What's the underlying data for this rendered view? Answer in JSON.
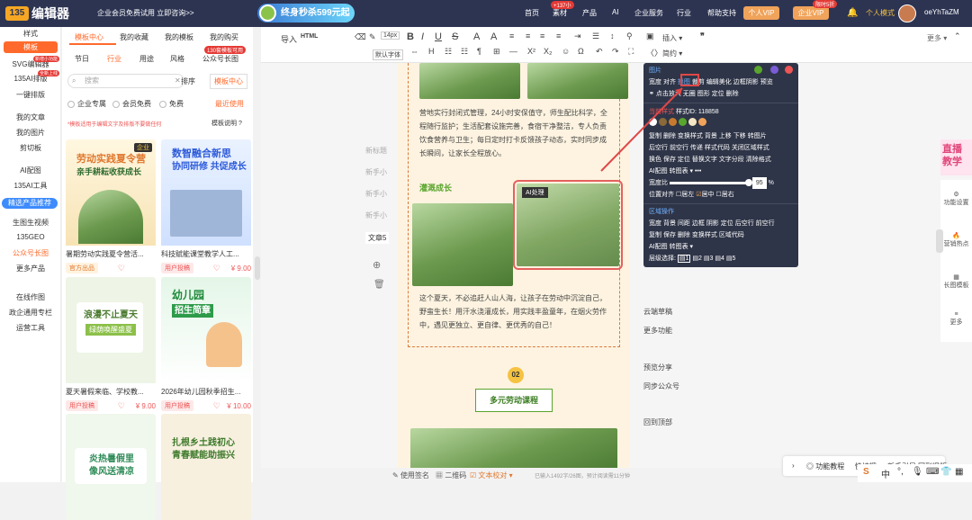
{
  "topbar": {
    "logo_text": "编辑器",
    "promo": "企业会员免费试用 立即咨询>>",
    "flash_sale": "终身秒杀599元起",
    "nav": [
      "首页",
      "素材",
      "产品",
      "AI",
      "企业服务",
      "行业",
      "帮助支持"
    ],
    "material_badge": "+137小",
    "vip": "个人VIP",
    "enterprise_vip": "企业VIP",
    "enterprise_badge": "限时5折",
    "mode": "个人模式",
    "username": "oeYhTaZM"
  },
  "leftnav": {
    "items": [
      "样式",
      "模板",
      "SVG编辑器",
      "135AI排版",
      "一键排版",
      "我的文章",
      "我的图片",
      "剪切板",
      "AI配图",
      "135AI工具",
      "精选产品推荐",
      "生图生视频",
      "135GEO",
      "公众号长图",
      "更多产品",
      "在线作图",
      "政企通用专栏",
      "运营工具"
    ],
    "badges": {
      "svg": "新增小功能",
      "ai": "全新上线"
    }
  },
  "panel": {
    "tabs": [
      "模板中心",
      "我的收藏",
      "我的模板",
      "我的购买"
    ],
    "subtabs": [
      "节日",
      "行业",
      "用途",
      "风格",
      "公众号长图"
    ],
    "long_badge": "130套模板可用",
    "search_placeholder": "搜索",
    "sort_label": "排序",
    "sort_value": "模板中心",
    "filters": [
      "企业专属",
      "会员免费",
      "免费"
    ],
    "recent": "最近使用",
    "notice": "*模板适用于编辑文字及排版不要做任何",
    "help": "模板说明"
  },
  "cards": [
    {
      "art1": "劳动实践夏令营",
      "art2": "亲手耕耘收获成长",
      "corner": "企业",
      "title": "暑期劳动实践夏令营活...",
      "tag": "官方出品",
      "price": ""
    },
    {
      "art1": "数智融合新思",
      "art2": "协同研修 共促成长",
      "corner": "",
      "title": "科技赋能课堂教学人工...",
      "tag": "用户投稿",
      "price": "¥ 9.00"
    },
    {
      "art1": "浪漫不止夏天",
      "art2": "绿荫唤醒盛夏",
      "corner": "",
      "title": "夏天暑假来临、学校教...",
      "tag": "用户投稿",
      "price": "¥ 9.00"
    },
    {
      "art1": "幼儿园",
      "art2": "招生简章",
      "corner": "",
      "title": "2026年幼儿园秋季招生...",
      "tag": "用户投稿",
      "price": "¥ 10.00"
    },
    {
      "art1": "炎热暑假里",
      "art2": "像风送清凉",
      "corner": "",
      "title": "",
      "tag": "",
      "price": ""
    },
    {
      "art1": "扎根乡土践初心",
      "art2": "青春赋能助振兴",
      "corner": "",
      "title": "",
      "tag": "",
      "price": ""
    }
  ],
  "toolbar": {
    "import": "导入",
    "html": "HTML",
    "font_size": "14px",
    "default_font": "默认字体",
    "insert": "插入",
    "brief": "简约",
    "more": "更多"
  },
  "ghosts": [
    "新标题",
    "新手小",
    "新手小",
    "新手小",
    "文章5"
  ],
  "doc": {
    "para1": "营地实行封闭式管理，24小时安保值守，师生配比科学，全程随行监护；生活配套设施完善，食宿干净整洁，专人负责饮食营养与卫生；每日定时打卡反馈孩子动态，实时同步成长瞬间，让家长全程放心。",
    "subtitle": "灌溉成长",
    "ai_label": "AI处理",
    "para2": "这个夏天，不必追赶人山人海，让孩子在劳动中沉淀自己，野蛮生长！用汗水浇灌成长，用实践丰盈童年，在烟火劳作中，遇见更独立、更自律、更优秀的自己！",
    "num": "02",
    "course": "多元劳动课程"
  },
  "floatmenu": {
    "img_header": "图片",
    "img_row1": [
      "宽度",
      "对齐",
      "换图",
      "裁剪",
      "编辑美化",
      "边框阴影",
      "预览"
    ],
    "img_row2": [
      "点击放大",
      "无圈",
      "图形",
      "定位",
      "删除"
    ],
    "style_header": "当前样式",
    "style_id": "样式ID: 118858",
    "style_rows": [
      [
        "复制",
        "删除",
        "变换样式",
        "背景",
        "上移",
        "下移",
        "转图片"
      ],
      [
        "后空行",
        "前空行",
        "传递",
        "样式代码",
        "关闭区域样式"
      ],
      [
        "换色",
        "保存",
        "定位",
        "替换文字",
        "文字分段",
        "清除格式"
      ],
      [
        "AI配图",
        "转图表"
      ]
    ],
    "width_label": "宽度比",
    "width_value": "95",
    "pos_label": "位置对齐",
    "pos_opts": [
      "居左",
      "居中",
      "居右"
    ],
    "area_header": "区域操作",
    "area_rows": [
      [
        "宽度",
        "背景",
        "间距",
        "边框",
        "阴影",
        "定位",
        "后空行",
        "前空行"
      ],
      [
        "复制",
        "保存",
        "删除",
        "变换样式",
        "区域代码"
      ],
      [
        "AI配图",
        "转图表"
      ]
    ],
    "layer_label": "层级选择:",
    "layers": [
      "1",
      "2",
      "3",
      "4",
      "5"
    ]
  },
  "sidebtns": [
    "云端草稿",
    "更多功能",
    "预览分享",
    "同步公众号",
    "回到顶部"
  ],
  "rightside": {
    "banner": "直播教学",
    "items": [
      "功能设置",
      "营销热点",
      "长图模板",
      "更多"
    ]
  },
  "bottom": {
    "sign": "使用签名",
    "qr": "二维码",
    "check": "文本校对",
    "stat": "已输入1492字/26图，预计阅读需11分钟"
  },
  "bar2": {
    "tutorial": "功能教程",
    "shortcut": "快捷键",
    "guide": "新手引导",
    "back": "回到旧版"
  },
  "ime": {
    "lang": "中"
  },
  "colors": {
    "topbar": "#2d3452",
    "accent": "#ff6a2c",
    "green": "#4caf50",
    "menu": "#2f3548"
  }
}
